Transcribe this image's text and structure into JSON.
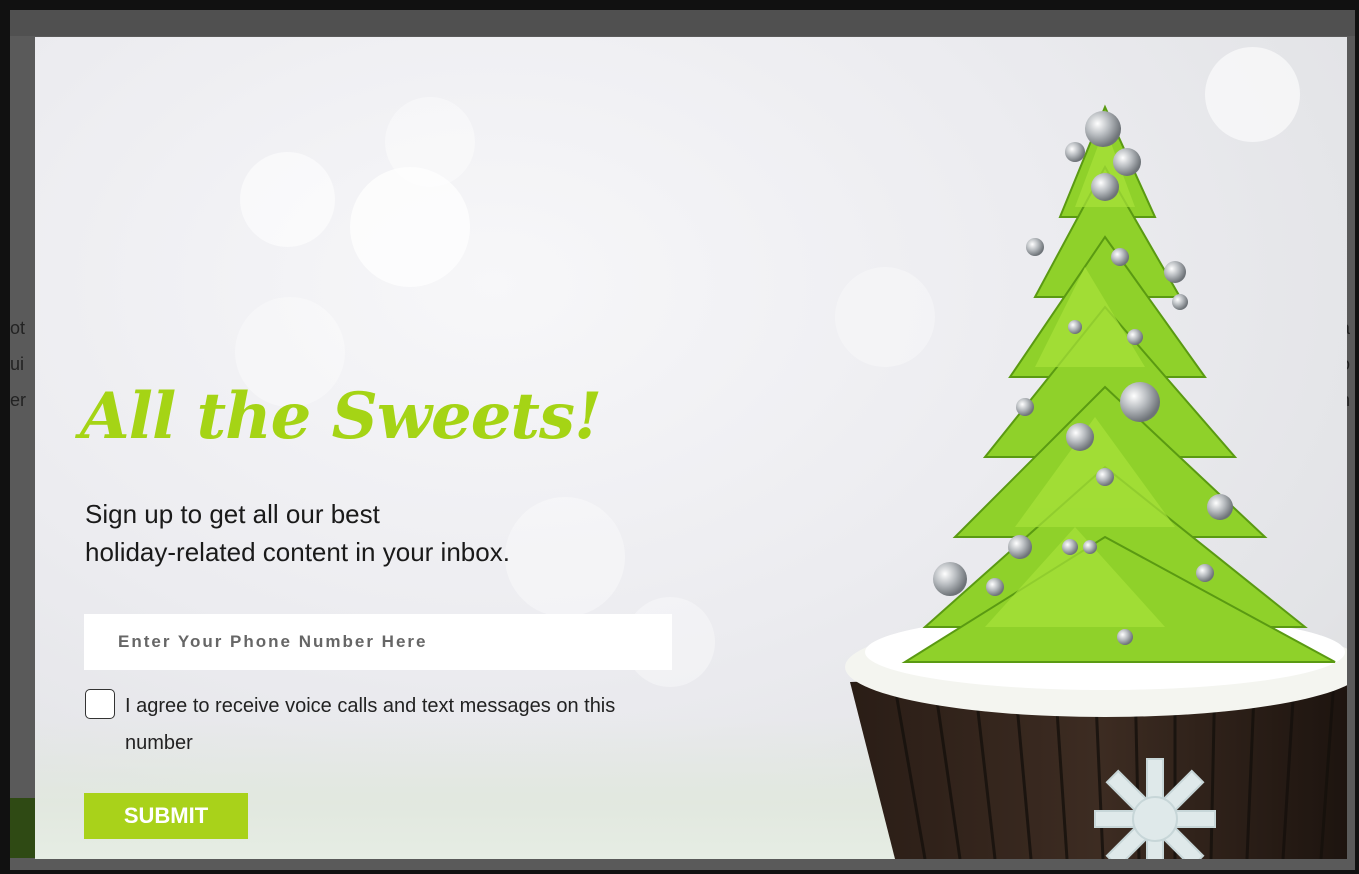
{
  "background_page": {
    "left_fragments": [
      "ot",
      "ui",
      "er"
    ],
    "right_fragments": [
      "a",
      "o",
      "n"
    ]
  },
  "popup": {
    "headline": "All the Sweets!",
    "subtext_line1": "Sign up to get all our best",
    "subtext_line2": "holiday-related content in your inbox.",
    "phone_placeholder": "Enter Your Phone Number Here",
    "phone_value": "",
    "consent_label": "I agree to receive voice calls and text messages on this number",
    "consent_checked": false,
    "submit_label": "SUBMIT"
  },
  "colors": {
    "accent_green": "#a9d21a",
    "headline_green": "#a5d415",
    "overlay": "#505050"
  }
}
